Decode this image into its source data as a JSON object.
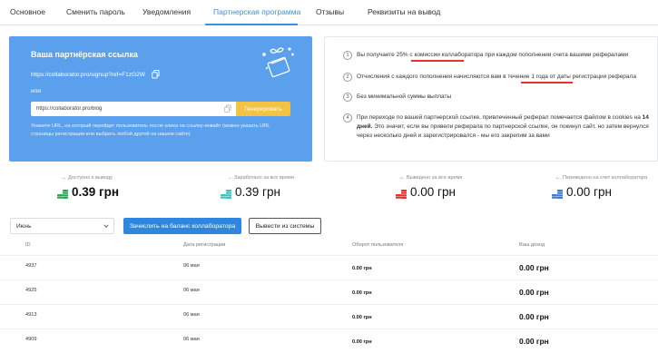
{
  "tabs": [
    {
      "label": "Основное"
    },
    {
      "label": "Сменить пароль"
    },
    {
      "label": "Уведомления"
    },
    {
      "label": "Партнерская программа",
      "active": true
    },
    {
      "label": "Отзывы"
    },
    {
      "label": "Реквизиты на вывод"
    }
  ],
  "referral": {
    "title": "Ваша партнёрская ссылка",
    "link": "https://collaborator.pro/signup?ref=F1zG2W",
    "or_label": "или",
    "url_value": "https://collaborator.pro/blog",
    "generate_label": "Генерировать",
    "hint": "Укажите URL, на который перейдет пользователь после клика на ссылку-инвайт (можно указать URL страницы регистрации или выбрать любой другой на нашем сайте)"
  },
  "info": [
    {
      "num": "1",
      "pre": "Вы получаете ",
      "hl": "25% с комиссии",
      "post": " коллаборатора при каждом пополнении счета вашими рефералами"
    },
    {
      "num": "2",
      "pre": "Отчисления с каждого пополнения начисляются вам ",
      "hl": "в течение 1 года",
      "post": " от даты регистрации реферала"
    },
    {
      "num": "3",
      "text": "Без минимальной суммы выплаты"
    },
    {
      "num": "4",
      "pre": "При переходе по вашей партнерской ссылке, привлеченный реферал помечается файлом в cookies на ",
      "bold": "14 дней.",
      "post": " Это значит, если вы привели реферала по партнерской ссылке, он покинул сайт, но затем вернулся через несколько дней и зарегистрировался - мы его закрепим за вами"
    }
  ],
  "stats": [
    {
      "label": "Доступно к выводу",
      "value": "0.39 грн",
      "arrow": "→",
      "arrow_color": "#2aa952",
      "coin_color": "#2aa952"
    },
    {
      "label": "Заработано за все время",
      "value": "0.39 грн",
      "arrow": "→",
      "arrow_color": "#3bc4c0",
      "coin_color": "#3bc4c0"
    },
    {
      "label": "Выведено за все время",
      "value": "0.00 грн",
      "arrow": "←",
      "arrow_color": "#e8332a",
      "coin_color": "#e8332a"
    },
    {
      "label": "Переведено на счет коллаборатора",
      "value": "0.00 грн",
      "arrow": "←",
      "arrow_color": "#3d7fd0",
      "coin_color": "#3d7fd0"
    }
  ],
  "controls": {
    "month": "Июнь",
    "credit_label": "Зачислить на баланс коллаборатора",
    "withdraw_label": "Вывести из системы"
  },
  "table": {
    "headers": [
      "ID",
      "Дата регистрации",
      "Оборот пользователя",
      "Ваш доход"
    ],
    "rows": [
      {
        "id": "4937",
        "date": "06 мая",
        "turnover": "0.00 грн",
        "income": "0.00 грн"
      },
      {
        "id": "4925",
        "date": "06 мая",
        "turnover": "0.00 грн",
        "income": "0.00 грн"
      },
      {
        "id": "4913",
        "date": "06 мая",
        "turnover": "0.00 грн",
        "income": "0.00 грн"
      },
      {
        "id": "4909",
        "date": "06 мая",
        "turnover": "0.00 грн",
        "income": "0.00 грн"
      }
    ]
  }
}
